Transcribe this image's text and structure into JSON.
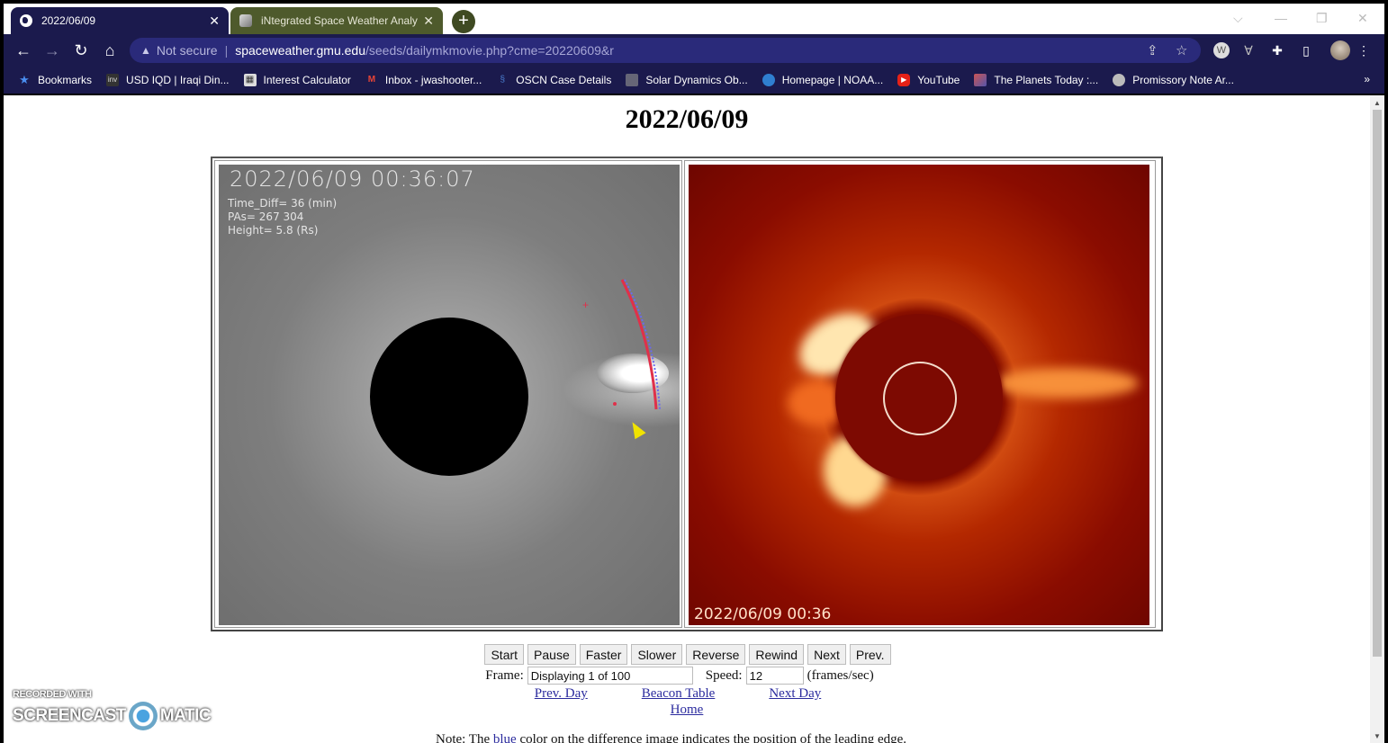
{
  "browser": {
    "tabs": [
      {
        "title": "2022/06/09",
        "active": true,
        "icon": "globe-icon"
      },
      {
        "title": "iNtegrated Space Weather Analy",
        "active": false,
        "icon": "site-favicon"
      }
    ],
    "new_tab_label": "+",
    "window_controls": {
      "dropdown": "⌵",
      "minimize": "—",
      "maximize": "❐",
      "close": "✕"
    },
    "address": {
      "security_label": "Not secure",
      "host": "spaceweather.gmu.edu",
      "path": "/seeds/dailymkmovie.php?cme=20220609&r"
    },
    "bookmarks": [
      {
        "label": "Bookmarks",
        "icon": "star-icon"
      },
      {
        "label": "USD IQD | Iraqi Din...",
        "icon": "investing-icon"
      },
      {
        "label": "Interest Calculator",
        "icon": "calculator-icon"
      },
      {
        "label": "Inbox - jwashooter...",
        "icon": "gmail-icon"
      },
      {
        "label": "OSCN Case Details",
        "icon": "oscn-icon"
      },
      {
        "label": "Solar Dynamics Ob...",
        "icon": "sdo-icon"
      },
      {
        "label": "Homepage | NOAA...",
        "icon": "noaa-icon"
      },
      {
        "label": "YouTube",
        "icon": "youtube-icon"
      },
      {
        "label": "The Planets Today :...",
        "icon": "planets-icon"
      },
      {
        "label": "Promissory Note Ar...",
        "icon": "promissory-icon"
      }
    ],
    "bookmarks_more": "»"
  },
  "page": {
    "title": "2022/06/09",
    "diff_image": {
      "timestamp": "2022/06/09 00:36:07",
      "info_lines": [
        "Time_Diff= 36 (min)",
        "PAs= 267 304",
        "Height= 5.8 (Rs)"
      ]
    },
    "lasco_image": {
      "timestamp": "2022/06/09 00:36"
    },
    "controls": {
      "buttons": [
        "Start",
        "Pause",
        "Faster",
        "Slower",
        "Reverse",
        "Rewind",
        "Next",
        "Prev."
      ],
      "frame_label": "Frame:",
      "frame_value": "Displaying 1 of 100",
      "speed_label": "Speed:",
      "speed_value": "12",
      "speed_unit": "(frames/sec)"
    },
    "links": {
      "prev_day": "Prev. Day",
      "beacon_table": "Beacon Table",
      "next_day": "Next Day",
      "home": "Home"
    },
    "note": {
      "prefix": "Note: The ",
      "highlight": "blue",
      "suffix": " color on the difference image indicates the position of the leading edge."
    }
  },
  "watermark": {
    "line1": "RECORDED WITH",
    "left": "SCREENCAST",
    "right": "MATIC"
  }
}
